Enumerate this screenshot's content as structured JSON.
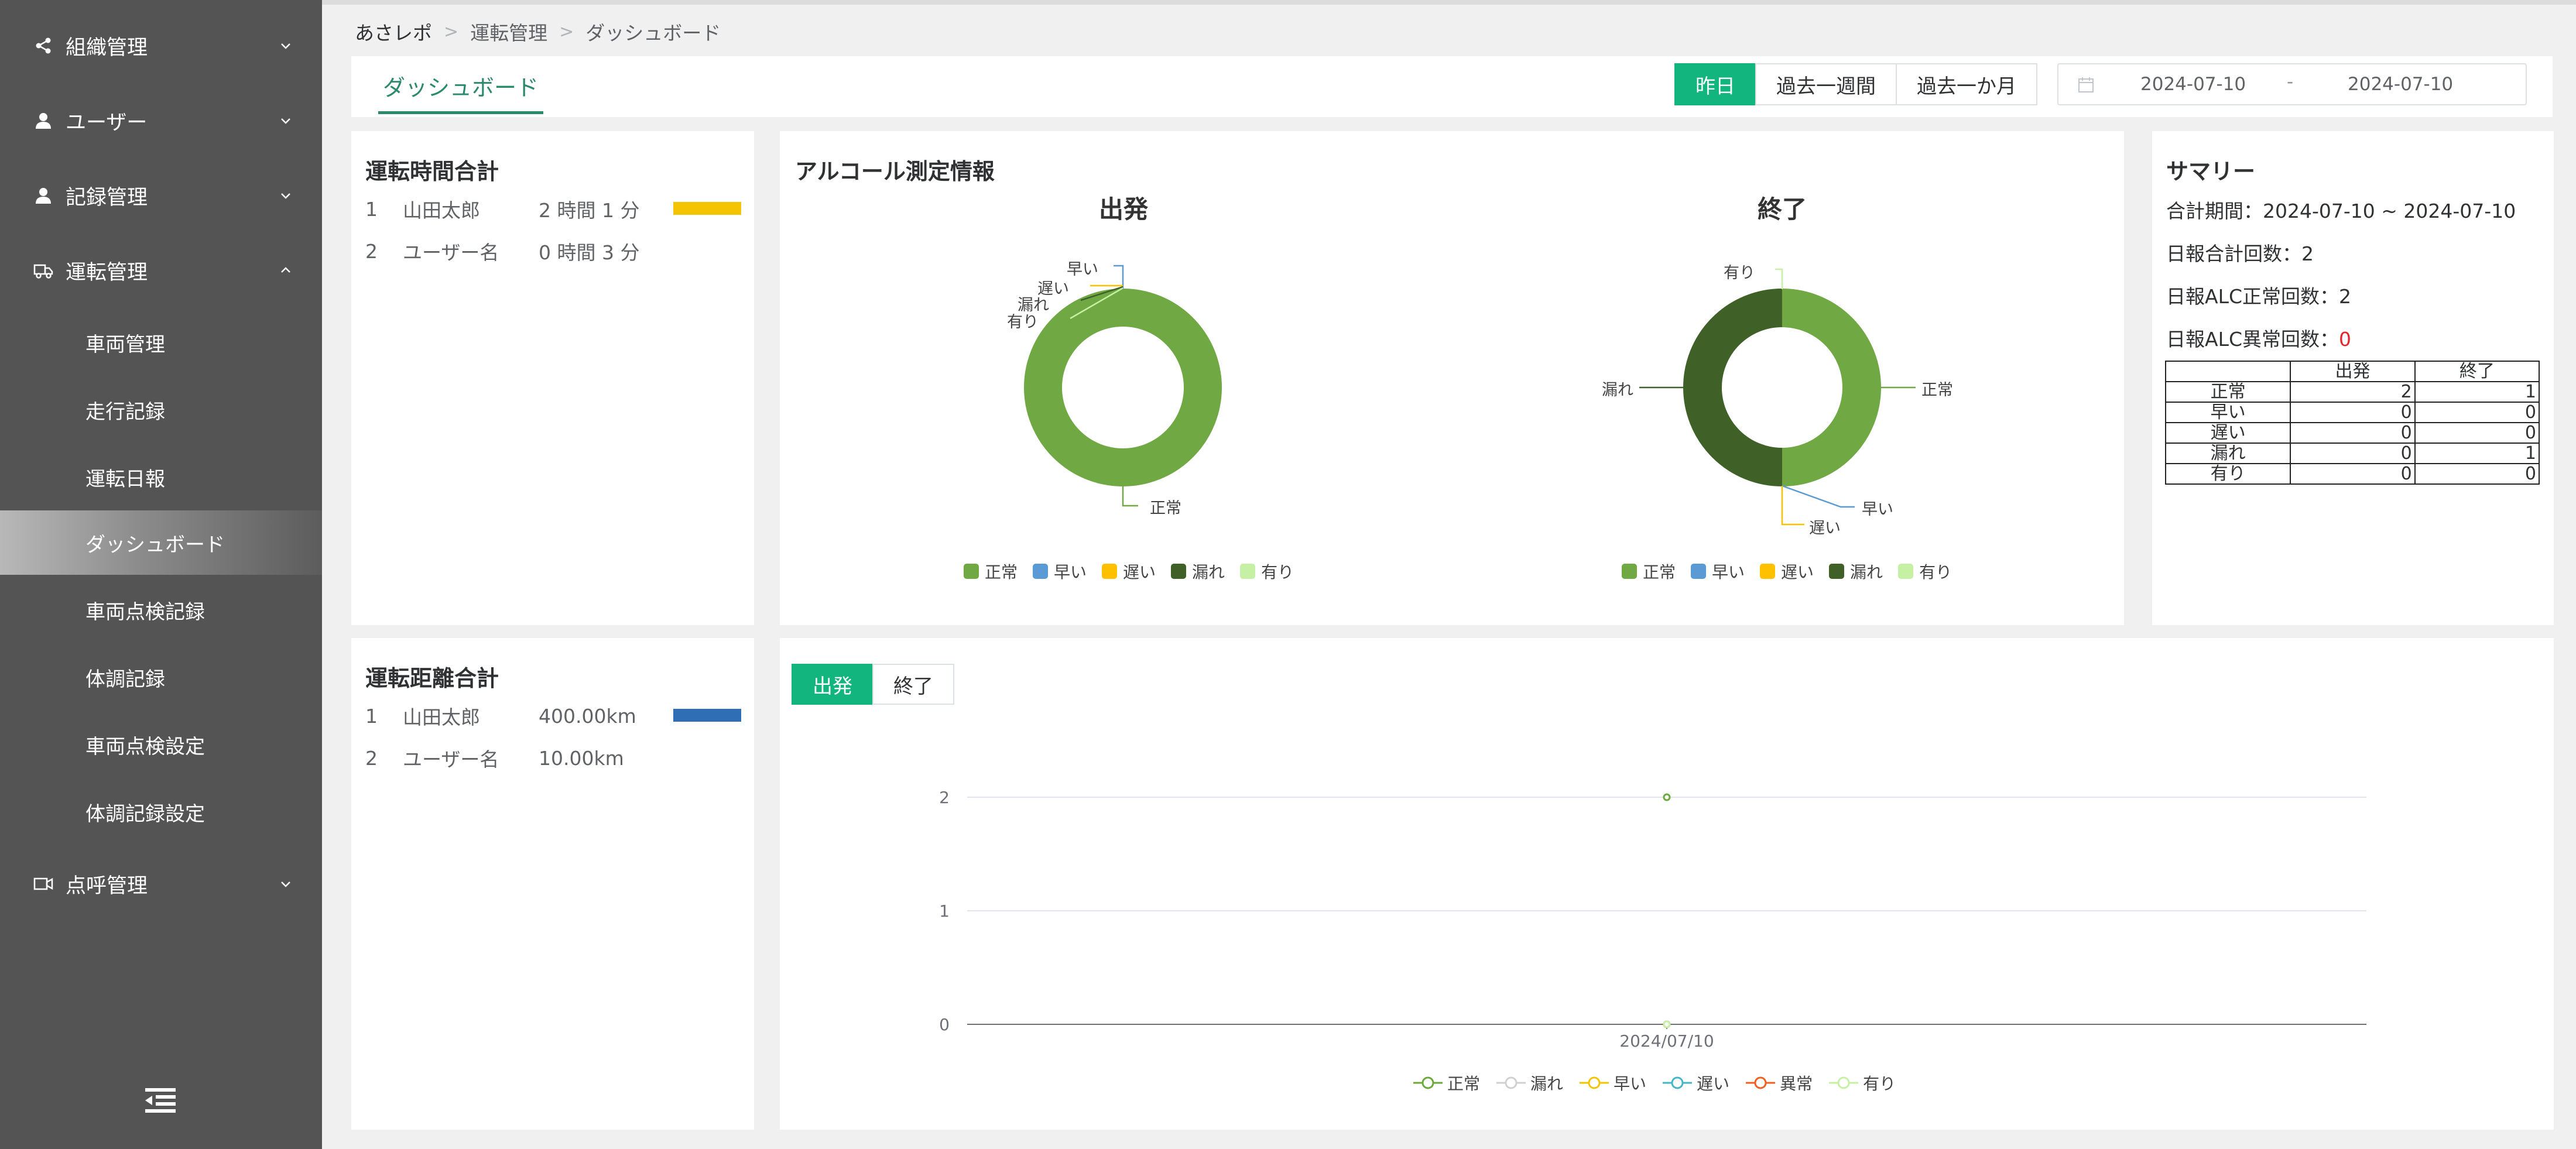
{
  "sidebar": {
    "groups": [
      {
        "label": "組織管理",
        "icon": "share-icon"
      },
      {
        "label": "ユーザー",
        "icon": "user-icon"
      },
      {
        "label": "記録管理",
        "icon": "user-icon"
      },
      {
        "label": "運転管理",
        "icon": "truck-icon"
      },
      {
        "label": "点呼管理",
        "icon": "video-icon"
      }
    ],
    "sub_items": [
      {
        "label": "車両管理"
      },
      {
        "label": "走行記録"
      },
      {
        "label": "運転日報"
      },
      {
        "label": "ダッシュボード",
        "active": true
      },
      {
        "label": "車両点検記録"
      },
      {
        "label": "体調記録"
      },
      {
        "label": "車両点検設定"
      },
      {
        "label": "体調記録設定"
      }
    ]
  },
  "breadcrumb": [
    "あさレポ",
    "運転管理",
    "ダッシュボード"
  ],
  "header": {
    "tab_label": "ダッシュボード",
    "range_buttons": [
      "昨日",
      "過去一週間",
      "過去一か月"
    ],
    "active_range": "昨日",
    "date_start": "2024-07-10",
    "date_separator": "-",
    "date_end": "2024-07-10"
  },
  "driving_time": {
    "title": "運転時間合計",
    "rows": [
      {
        "rank": "1",
        "name": "山田太郎",
        "value": "2 時間 1 分",
        "bar_fraction": 1.0
      },
      {
        "rank": "2",
        "name": "ユーザー名",
        "value": "0 時間 3 分",
        "bar_fraction": 0.0
      }
    ],
    "bar_color": "#f5c400"
  },
  "driving_distance": {
    "title": "運転距離合計",
    "rows": [
      {
        "rank": "1",
        "name": "山田太郎",
        "value": "400.00km",
        "bar_fraction": 1.0
      },
      {
        "rank": "2",
        "name": "ユーザー名",
        "value": "10.00km",
        "bar_fraction": 0.0
      }
    ],
    "bar_color": "#2f6db5"
  },
  "alcohol": {
    "title": "アルコール測定情報",
    "legend": [
      {
        "label": "正常",
        "color": "#70a844"
      },
      {
        "label": "早い",
        "color": "#5b9bd5"
      },
      {
        "label": "遅い",
        "color": "#ffc000"
      },
      {
        "label": "漏れ",
        "color": "#3f6128"
      },
      {
        "label": "有り",
        "color": "#c6f0a4"
      }
    ],
    "start_title": "出発",
    "end_title": "終了",
    "start_labels": {
      "fast": "早い",
      "slow": "遅い",
      "missing": "漏れ",
      "present": "有り",
      "normal": "正常"
    },
    "end_labels": {
      "present": "有り",
      "missing": "漏れ",
      "normal": "正常",
      "fast": "早い",
      "slow": "遅い"
    }
  },
  "summary": {
    "title": "サマリー",
    "period_label": "合計期間：",
    "period_value": "2024-07-10 ~ 2024-07-10",
    "report_count_label": "日報合計回数：",
    "report_count": "2",
    "alc_normal_label": "日報ALC正常回数：",
    "alc_normal": "2",
    "alc_abnormal_label": "日報ALC異常回数：",
    "alc_abnormal": "0",
    "table": {
      "headers": [
        "",
        "出発",
        "終了"
      ],
      "rows": [
        [
          "正常",
          "2",
          "1"
        ],
        [
          "早い",
          "0",
          "0"
        ],
        [
          "遅い",
          "0",
          "0"
        ],
        [
          "漏れ",
          "0",
          "1"
        ],
        [
          "有り",
          "0",
          "0"
        ]
      ]
    }
  },
  "trend": {
    "tabs": [
      "出発",
      "終了"
    ],
    "active_tab": "出発",
    "legend": [
      {
        "label": "正常",
        "color": "#6aaa3a"
      },
      {
        "label": "漏れ",
        "color": "#d0d0d0"
      },
      {
        "label": "早い",
        "color": "#f5c400"
      },
      {
        "label": "遅い",
        "color": "#45b5c8"
      },
      {
        "label": "異常",
        "color": "#f06020"
      },
      {
        "label": "有り",
        "color": "#c6f0a4"
      }
    ]
  },
  "chart_data": [
    {
      "type": "pie",
      "title": "出発",
      "categories": [
        "正常",
        "早い",
        "遅い",
        "漏れ",
        "有り"
      ],
      "values": [
        2,
        0,
        0,
        0,
        0
      ],
      "colors": [
        "#70a844",
        "#5b9bd5",
        "#ffc000",
        "#3f6128",
        "#c6f0a4"
      ],
      "legend_position": "bottom"
    },
    {
      "type": "pie",
      "title": "終了",
      "categories": [
        "正常",
        "早い",
        "遅い",
        "漏れ",
        "有り"
      ],
      "values": [
        1,
        0,
        0,
        1,
        0
      ],
      "colors": [
        "#70a844",
        "#5b9bd5",
        "#ffc000",
        "#3f6128",
        "#c6f0a4"
      ],
      "legend_position": "bottom"
    },
    {
      "type": "line",
      "x": [
        "2024/07/10"
      ],
      "series": [
        {
          "name": "正常",
          "values": [
            2
          ],
          "color": "#6aaa3a"
        },
        {
          "name": "漏れ",
          "values": [
            0
          ],
          "color": "#d0d0d0"
        },
        {
          "name": "早い",
          "values": [
            0
          ],
          "color": "#f5c400"
        },
        {
          "name": "遅い",
          "values": [
            0
          ],
          "color": "#45b5c8"
        },
        {
          "name": "異常",
          "values": [
            0
          ],
          "color": "#f06020"
        },
        {
          "name": "有り",
          "values": [
            0
          ],
          "color": "#c6f0a4"
        }
      ],
      "ylim": [
        0,
        2
      ],
      "yticks": [
        0,
        1,
        2
      ],
      "grid": true,
      "legend_position": "bottom"
    }
  ]
}
